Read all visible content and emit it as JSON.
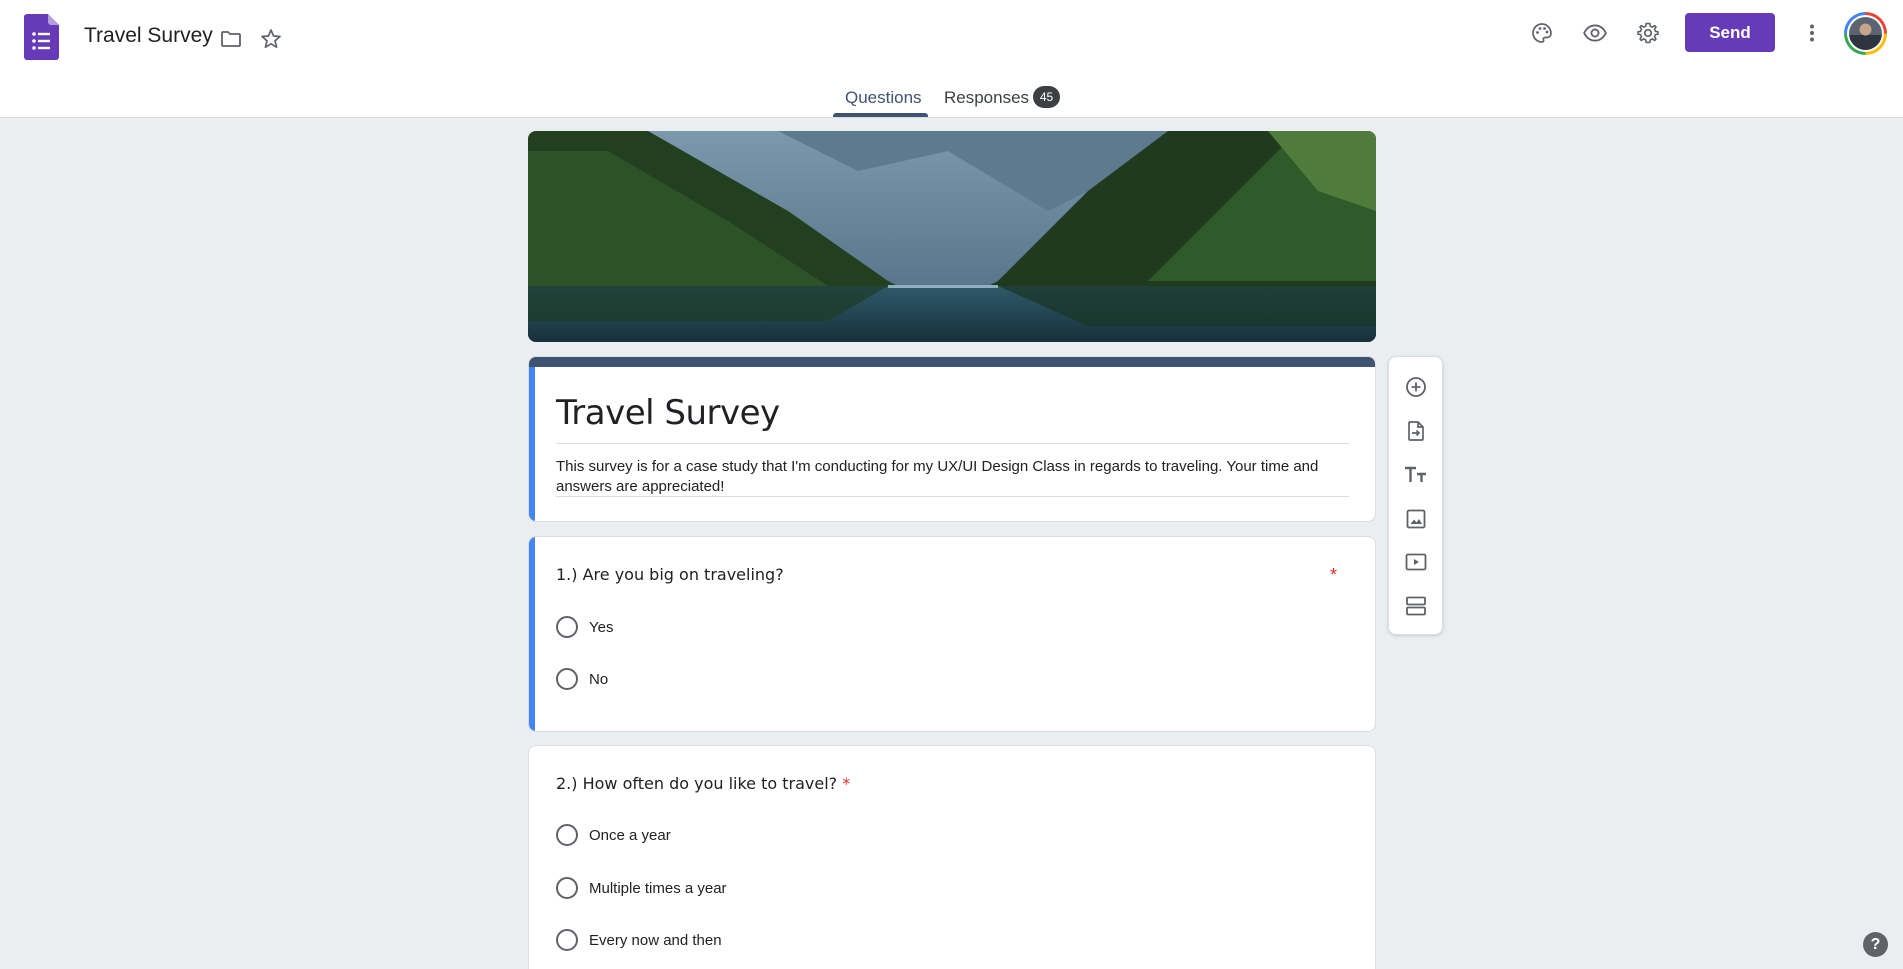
{
  "header": {
    "title": "Travel Survey",
    "send_label": "Send",
    "icons": [
      "forms-app-icon",
      "folder-icon",
      "star-icon",
      "palette-icon",
      "eye-icon",
      "gear-icon",
      "more-vert-icon"
    ]
  },
  "tabs": {
    "questions": "Questions",
    "responses": "Responses",
    "responses_count": "45"
  },
  "form": {
    "title": "Travel Survey",
    "description": "This survey is for a case study that I'm conducting for my UX/UI Design Class in regards to traveling. Your time and answers are appreciated!"
  },
  "questions": [
    {
      "title": "1.) Are you big on traveling?",
      "required_mark": "*",
      "options": [
        "Yes",
        "No"
      ]
    },
    {
      "title": "2.) How often do you like to travel?",
      "required_mark": "*",
      "options": [
        "Once a year",
        "Multiple times a year",
        "Every now and then"
      ]
    }
  ],
  "toolbar": {
    "items": [
      "add-question-icon",
      "import-questions-icon",
      "add-title-icon",
      "add-image-icon",
      "add-video-icon",
      "add-section-icon"
    ]
  },
  "help": "?",
  "colors": {
    "brand": "#673ab7",
    "theme": "#3f5372",
    "accent": "#4285f4",
    "required": "#d93025"
  }
}
